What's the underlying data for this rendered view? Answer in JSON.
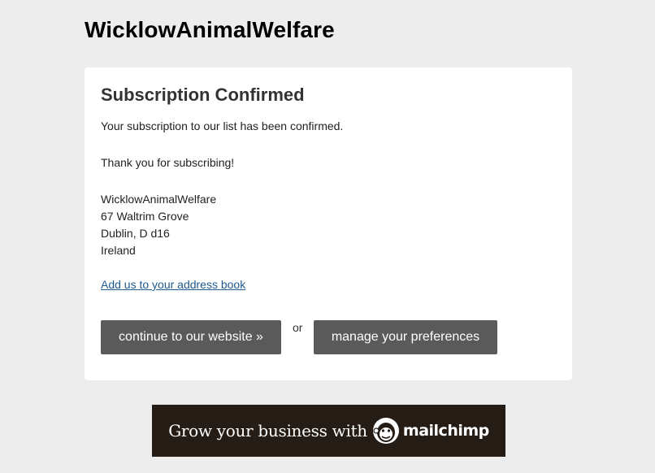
{
  "header": {
    "org_name": "WicklowAnimalWelfare"
  },
  "card": {
    "title": "Subscription Confirmed",
    "confirm_message": "Your subscription to our list has been confirmed.",
    "thanks_message": "Thank you for subscribing!",
    "address": {
      "line1": "WicklowAnimalWelfare",
      "line2": "67 Waltrim Grove",
      "line3": "Dublin, D d16",
      "line4": "Ireland"
    },
    "address_book_link": "Add us to your address book",
    "website_button": "continue to our website »",
    "or_text": "or",
    "preferences_button": "manage your preferences"
  },
  "banner": {
    "text": "Grow your business with",
    "brand": "mailchimp",
    "icon": "mailchimp-freddie-icon",
    "background": "#241c15"
  }
}
